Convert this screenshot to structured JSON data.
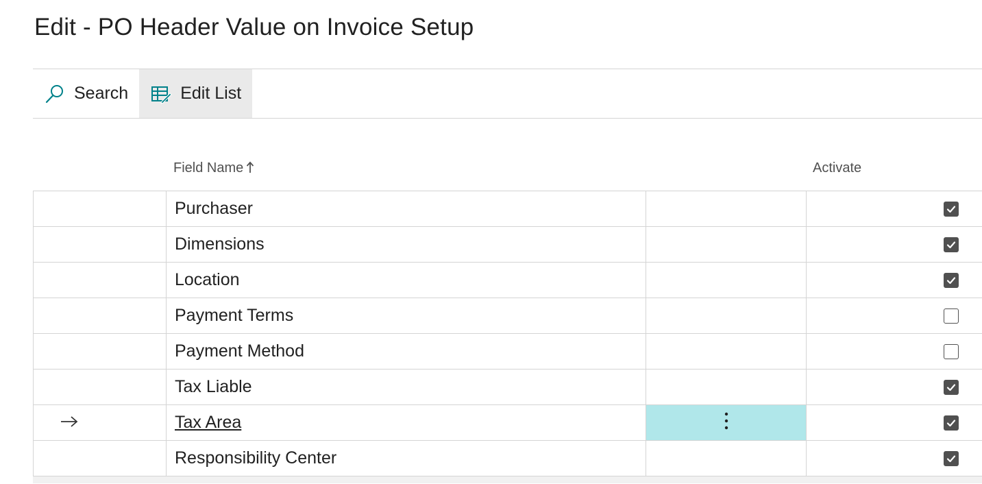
{
  "page": {
    "title": "Edit - PO Header Value on Invoice Setup"
  },
  "toolbar": {
    "search_label": "Search",
    "edit_list_label": "Edit List"
  },
  "grid": {
    "columns": {
      "field_name": "Field Name",
      "activate": "Activate"
    },
    "sort_indicator": "ascending",
    "rows": [
      {
        "field_name": "Purchaser",
        "activate": true,
        "current": false
      },
      {
        "field_name": "Dimensions",
        "activate": true,
        "current": false
      },
      {
        "field_name": "Location",
        "activate": true,
        "current": false
      },
      {
        "field_name": "Payment Terms",
        "activate": false,
        "current": false
      },
      {
        "field_name": "Payment Method",
        "activate": false,
        "current": false
      },
      {
        "field_name": "Tax Liable",
        "activate": true,
        "current": false
      },
      {
        "field_name": "Tax Area",
        "activate": true,
        "current": true
      },
      {
        "field_name": "Responsibility Center",
        "activate": true,
        "current": false
      }
    ]
  },
  "colors": {
    "accent": "#00818a",
    "selected_cell": "#b0e7ea",
    "checkbox": "#505050",
    "toolbar_active": "#eaeaea"
  }
}
